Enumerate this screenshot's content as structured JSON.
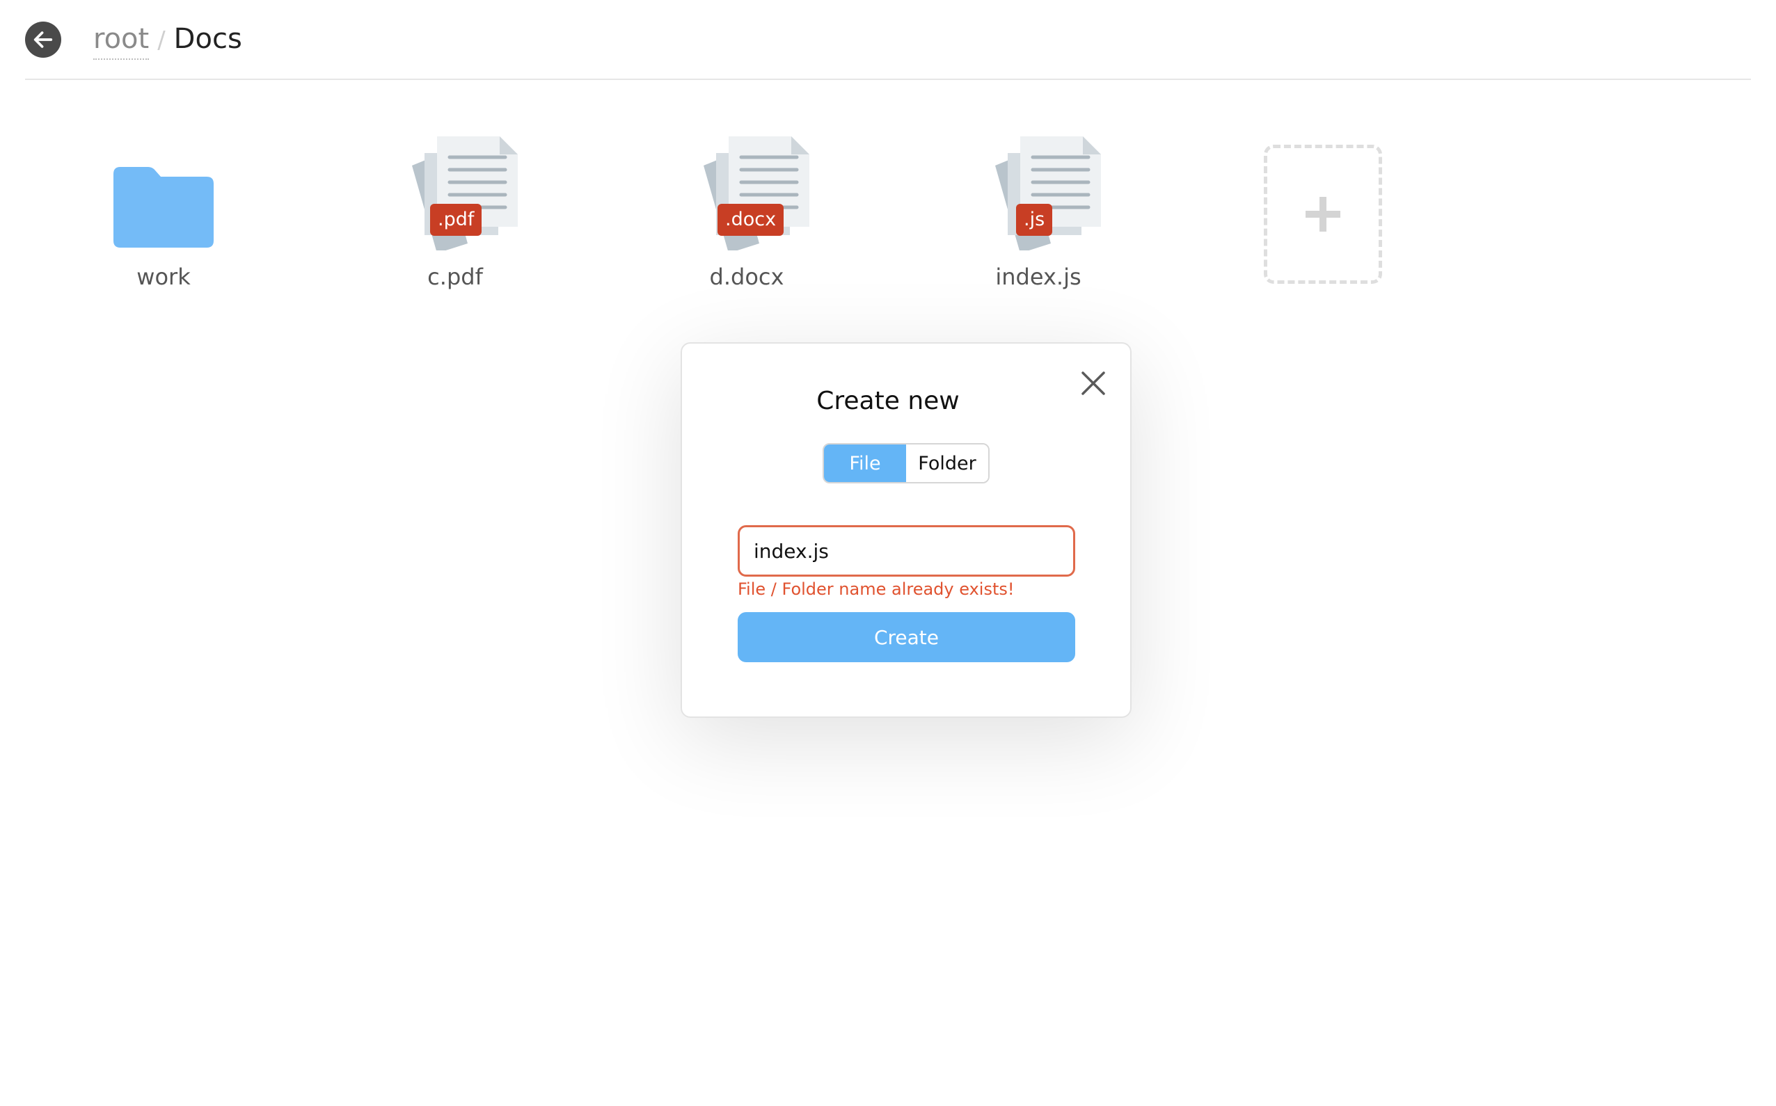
{
  "header": {
    "back_icon": "arrow-left-icon",
    "breadcrumb": {
      "root": "root",
      "separator": "/",
      "current": "Docs"
    }
  },
  "items": [
    {
      "name": "work",
      "kind": "folder",
      "icon": "folder-icon"
    },
    {
      "name": "c.pdf",
      "kind": "file",
      "ext": ".pdf",
      "icon": "document-icon"
    },
    {
      "name": "d.docx",
      "kind": "file",
      "ext": ".docx",
      "icon": "document-icon"
    },
    {
      "name": "index.js",
      "kind": "file",
      "ext": ".js",
      "icon": "document-icon"
    }
  ],
  "add_tile": {
    "icon": "plus-icon"
  },
  "modal": {
    "title": "Create new",
    "close_icon": "close-icon",
    "toggle": {
      "file_label": "File",
      "folder_label": "Folder",
      "selected": "File"
    },
    "input_value": "index.js",
    "error": "File / Folder name already exists!",
    "create_label": "Create"
  },
  "colors": {
    "accent": "#64b5f6",
    "folder": "#74bbf7",
    "badge": "#c83e24",
    "error": "#e0522f",
    "back_button": "#4a4a4a"
  }
}
